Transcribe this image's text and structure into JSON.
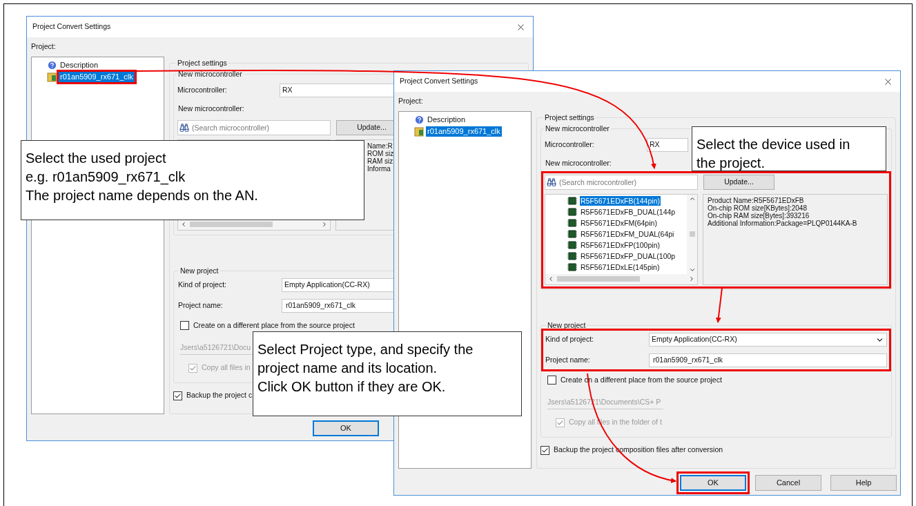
{
  "windows": [
    {
      "title": "Project Convert Settings",
      "project_label": "Project:",
      "tree": [
        {
          "label": "Description",
          "kind": "help",
          "selected": false,
          "highlighted": false
        },
        {
          "label": "r01an5909_rx671_clk",
          "kind": "project",
          "selected": true,
          "highlighted": true
        }
      ],
      "settings": {
        "label": "Project settings",
        "mc_group_label": "New microcontroller",
        "mc_label": "Microcontroller:",
        "mc_value": "RX",
        "new_mc_label": "New microcontroller:",
        "search_placeholder": "(Search microcontroller)",
        "update_button": "Update...",
        "highlighted": false,
        "info_lines": [
          "Name:R",
          "ROM siz",
          "RAM siz",
          "Informa"
        ]
      },
      "new_project": {
        "label": "New project",
        "highlighted": false,
        "kind_label": "Kind of project:",
        "kind_value": "Empty Application(CC-RX)",
        "name_label": "Project name:",
        "name_value": "r01an5909_rx671_clk",
        "create": {
          "label": "Create on a different place from the source project",
          "checked": false
        },
        "path": {
          "value": "Jsers\\a5126721\\Docu",
          "disabled": true
        },
        "copy": {
          "label": "Copy all files in",
          "checked": true,
          "disabled": true
        }
      },
      "backup": {
        "label": "Backup the project c",
        "checked": true
      },
      "buttons": [
        {
          "label": "OK",
          "default": true,
          "highlighted": false
        }
      ]
    },
    {
      "title": "Project Convert Settings",
      "project_label": "Project:",
      "tree": [
        {
          "label": "Description",
          "kind": "help",
          "selected": false,
          "highlighted": false
        },
        {
          "label": "r01an5909_rx671_clk",
          "kind": "project",
          "selected": true,
          "highlighted": false
        }
      ],
      "settings": {
        "label": "Project settings",
        "mc_group_label": "New microcontroller",
        "mc_label": "Microcontroller:",
        "mc_value": "RX",
        "new_mc_label": "New microcontroller:",
        "search_placeholder": "(Search microcontroller)",
        "update_button": "Update...",
        "highlighted": true,
        "devices": [
          {
            "label": "R5F5671EDxFB(144pin)",
            "selected": true
          },
          {
            "label": "R5F5671EDxFB_DUAL(144p",
            "selected": false
          },
          {
            "label": "R5F5671EDxFM(64pin)",
            "selected": false
          },
          {
            "label": "R5F5671EDxFM_DUAL(64pi",
            "selected": false
          },
          {
            "label": "R5F5671EDxFP(100pin)",
            "selected": false
          },
          {
            "label": "R5F5671EDxFP_DUAL(100p",
            "selected": false
          },
          {
            "label": "R5F5671EDxLE(145pin)",
            "selected": false
          }
        ],
        "info_lines": [
          "Product Name:R5F5671EDxFB",
          "On-chip ROM size[KBytes]:2048",
          "On-chip RAM size[Bytes]:393216",
          "Additional Information:Package=PLQP0144KA-B"
        ]
      },
      "new_project": {
        "label": "New project",
        "highlighted": true,
        "kind_label": "Kind of project:",
        "kind_value": "Empty Application(CC-RX)",
        "dropdown": true,
        "name_label": "Project name:",
        "name_value": "r01an5909_rx671_clk",
        "create": {
          "label": "Create on a different place from the source project",
          "checked": false
        },
        "path": {
          "value": "Jsers\\a5126721\\Documents\\CS+ P",
          "disabled": true
        },
        "copy": {
          "label": "Copy all files in the folder of t",
          "checked": true,
          "disabled": true
        }
      },
      "backup": {
        "label": "Backup the project composition files after conversion",
        "checked": true
      },
      "buttons": [
        {
          "label": "OK",
          "default": true,
          "highlighted": true
        },
        {
          "label": "Cancel",
          "default": false,
          "highlighted": false
        },
        {
          "label": "Help",
          "default": false,
          "highlighted": false
        }
      ]
    }
  ],
  "callouts": [
    {
      "lines": [
        "Select the used project",
        "e.g. r01an5909_rx671_clk",
        "The project name depends on the AN."
      ]
    },
    {
      "lines": [
        "Select the device used in",
        "the project."
      ]
    },
    {
      "lines": [
        "Select Project type, and specify the",
        "project name and its location.",
        "Click OK button if they are OK."
      ]
    }
  ]
}
